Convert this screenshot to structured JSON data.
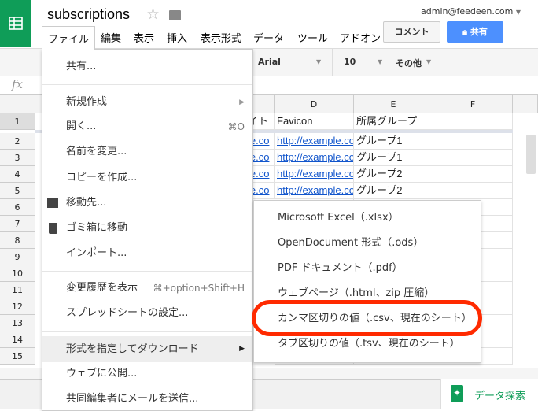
{
  "app": {
    "title": "subscriptions",
    "account": "admin@feedeen.com",
    "accent": "#0f9d58"
  },
  "menubar": [
    "ファイル",
    "編集",
    "表示",
    "挿入",
    "表示形式",
    "データ",
    "ツール",
    "アドオン"
  ],
  "buttons": {
    "comment": "コメント",
    "share": "共有",
    "share_color": "#4d90fe"
  },
  "toolbar": {
    "font": "Arial",
    "size": "10",
    "more": "その他"
  },
  "formula": {
    "icon": "fx"
  },
  "grid": {
    "columns": [
      "D",
      "E",
      "F"
    ],
    "rows": [
      "1",
      "2",
      "3",
      "4",
      "5",
      "6",
      "7",
      "8",
      "9",
      "10",
      "11",
      "12",
      "13",
      "14",
      "15"
    ],
    "c_partial": [
      "イト",
      "le.co",
      "le.co",
      "le.co",
      "le.co"
    ],
    "d": [
      "Favicon",
      "http://example.co",
      "http://example.co",
      "http://example.co",
      "http://example.co"
    ],
    "e": [
      "所属グループ",
      "グループ1",
      "グループ1",
      "グループ2",
      "グループ2"
    ]
  },
  "file_menu": [
    {
      "label": "共有..."
    },
    {
      "label": "新規作成",
      "submenu": true
    },
    {
      "label": "開く...",
      "shortcut": "⌘O"
    },
    {
      "label": "名前を変更..."
    },
    {
      "label": "コピーを作成..."
    },
    {
      "label": "移動先...",
      "icon": "folder-icon"
    },
    {
      "label": "ゴミ箱に移動",
      "icon": "trash-icon"
    },
    {
      "label": "インポート..."
    },
    {
      "label": "変更履歴を表示",
      "shortcut": "⌘+option+Shift+H"
    },
    {
      "label": "スプレッドシートの設定..."
    },
    {
      "label": "形式を指定してダウンロード",
      "submenu": true
    },
    {
      "label": "ウェブに公開..."
    },
    {
      "label": "共同編集者にメールを送信..."
    }
  ],
  "download_menu": [
    "Microsoft Excel（.xlsx）",
    "OpenDocument 形式（.ods）",
    "PDF ドキュメント（.pdf）",
    "ウェブページ（.html、zip 圧縮）",
    "カンマ区切りの値（.csv、現在のシート）",
    "タブ区切りの値（.tsv、現在のシート）"
  ],
  "highlight_color": "#ff2a00",
  "explore": {
    "label": "データ探索"
  }
}
